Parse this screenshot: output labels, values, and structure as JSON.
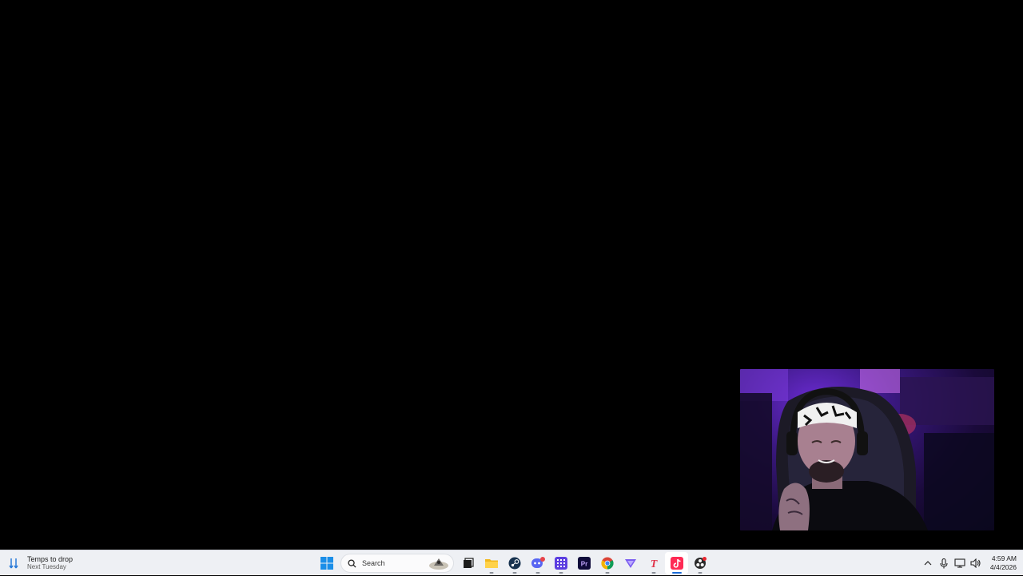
{
  "widget": {
    "title": "Temps to drop",
    "subtitle": "Next Tuesday",
    "icon": "weather-rain-icon"
  },
  "search": {
    "placeholder": "Search"
  },
  "taskbar_apps": [
    {
      "name": "start",
      "icon": "windows-logo-icon"
    },
    {
      "name": "task-view",
      "icon": "task-view-icon"
    },
    {
      "name": "file-explorer",
      "icon": "folder-icon"
    },
    {
      "name": "steam",
      "icon": "steam-icon"
    },
    {
      "name": "discord",
      "icon": "discord-icon",
      "badge": "9+"
    },
    {
      "name": "app-grid",
      "icon": "grid-app-icon"
    },
    {
      "name": "premiere-pro",
      "icon": "premiere-pro-icon",
      "label": "Pr"
    },
    {
      "name": "chrome",
      "icon": "chrome-icon"
    },
    {
      "name": "vpn",
      "icon": "vpn-triangle-icon"
    },
    {
      "name": "text-app",
      "icon": "t-app-icon",
      "label": "T"
    },
    {
      "name": "tiktok",
      "icon": "tiktok-icon",
      "active": true
    },
    {
      "name": "obs",
      "icon": "obs-icon"
    }
  ],
  "tray": {
    "icons": [
      "chevron-up-icon",
      "microphone-icon",
      "network-icon",
      "volume-icon"
    ]
  },
  "clock": {
    "time": "4:59 AM",
    "date": "4/4/2026"
  },
  "colors": {
    "taskbar": "#eef0f4",
    "accent": "#1a6cd8",
    "desktop": "#000000"
  }
}
